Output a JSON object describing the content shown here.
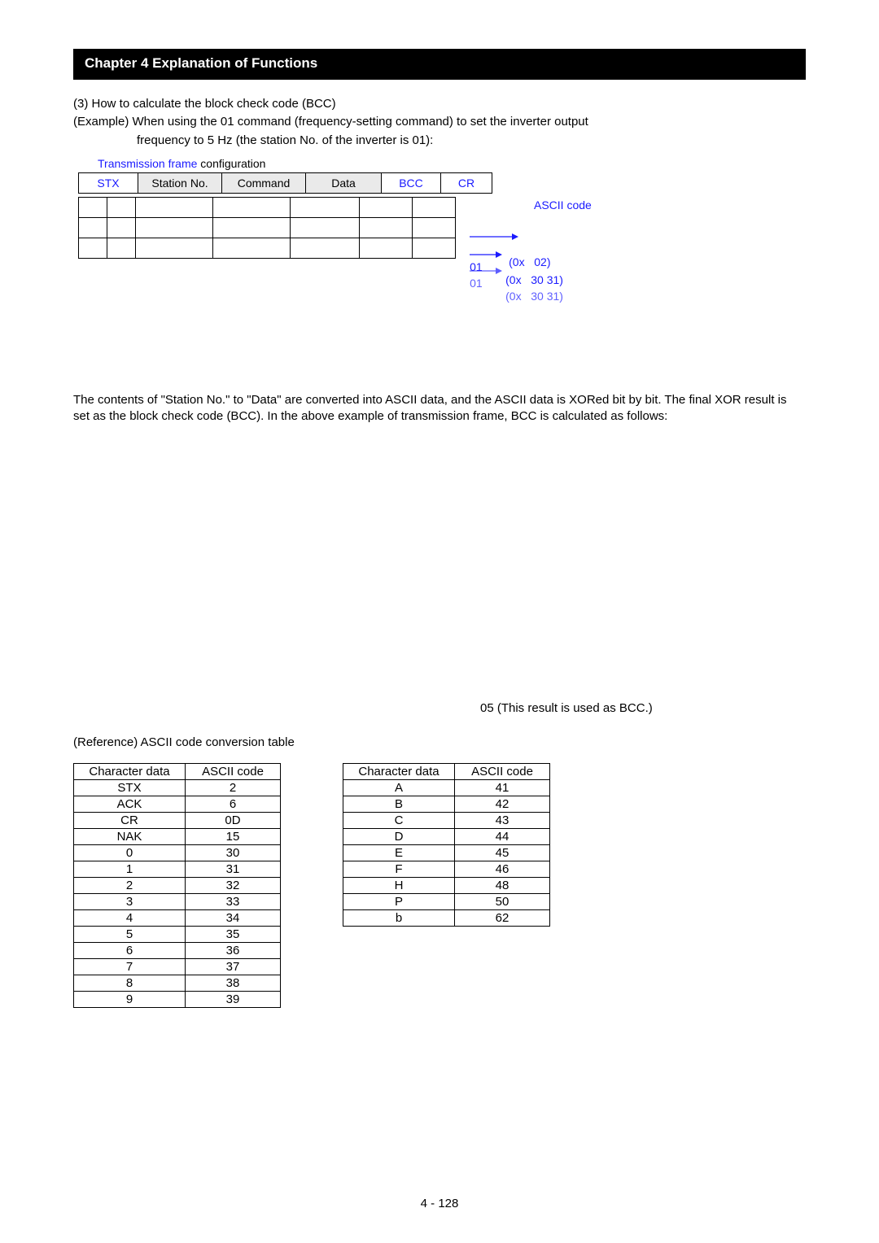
{
  "chapter_title": "Chapter 4 Explanation of Functions",
  "section_line": "(3) How to calculate the block check code (BCC)",
  "example_lead": "(Example)   When using the 01 command (frequency-setting command) to set the inverter output",
  "example_line2": "frequency to 5 Hz (the station No. of the inverter is 01):",
  "frame_caption_blue": "Transmission frame",
  "frame_caption_black": " configuration",
  "frame_cells": {
    "stx": "STX",
    "station_no": "Station No.",
    "command": "Command",
    "data": "Data",
    "bcc": "BCC",
    "cr": "CR"
  },
  "ascii_label": "ASCII code",
  "ascii_rows": [
    {
      "val": "",
      "code": "(0x   02)"
    },
    {
      "val": "01",
      "code": "(0x   30 31)"
    },
    {
      "val": "01",
      "code": "(0x   30 31)"
    }
  ],
  "bcc_paragraph": "The contents of \"Station No.\" to \"Data\" are converted into ASCII data, and the ASCII data is XORed bit by bit. The final XOR result is set as the block check code (BCC). In the above example of transmission frame, BCC is calculated as follows:",
  "bcc_result": "05 (This result is used as BCC.)",
  "ref_title": "(Reference) ASCII code conversion table",
  "ref_table1_header": [
    "Character data",
    "ASCII code"
  ],
  "ref_table1_rows": [
    [
      "STX",
      "2"
    ],
    [
      "ACK",
      "6"
    ],
    [
      "CR",
      "0D"
    ],
    [
      "NAK",
      "15"
    ],
    [
      "0",
      "30"
    ],
    [
      "1",
      "31"
    ],
    [
      "2",
      "32"
    ],
    [
      "3",
      "33"
    ],
    [
      "4",
      "34"
    ],
    [
      "5",
      "35"
    ],
    [
      "6",
      "36"
    ],
    [
      "7",
      "37"
    ],
    [
      "8",
      "38"
    ],
    [
      "9",
      "39"
    ]
  ],
  "ref_table2_header": [
    "Character data",
    "ASCII code"
  ],
  "ref_table2_rows": [
    [
      "A",
      "41"
    ],
    [
      "B",
      "42"
    ],
    [
      "C",
      "43"
    ],
    [
      "D",
      "44"
    ],
    [
      "E",
      "45"
    ],
    [
      "F",
      "46"
    ],
    [
      "H",
      "48"
    ],
    [
      "P",
      "50"
    ],
    [
      "b",
      "62"
    ]
  ],
  "page_number": "4 - 128"
}
